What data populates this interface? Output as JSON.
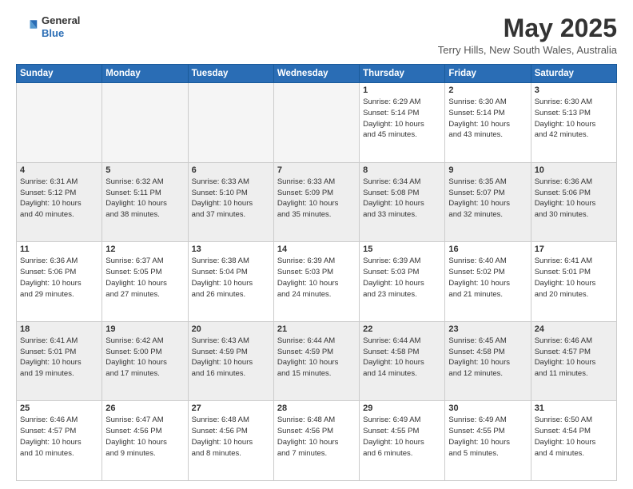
{
  "header": {
    "logo_general": "General",
    "logo_blue": "Blue",
    "title": "May 2025",
    "subtitle": "Terry Hills, New South Wales, Australia"
  },
  "calendar": {
    "days_of_week": [
      "Sunday",
      "Monday",
      "Tuesday",
      "Wednesday",
      "Thursday",
      "Friday",
      "Saturday"
    ],
    "weeks": [
      {
        "style": "white",
        "days": [
          {
            "num": "",
            "info": "",
            "empty": true
          },
          {
            "num": "",
            "info": "",
            "empty": true
          },
          {
            "num": "",
            "info": "",
            "empty": true
          },
          {
            "num": "",
            "info": "",
            "empty": true
          },
          {
            "num": "1",
            "info": "Sunrise: 6:29 AM\nSunset: 5:14 PM\nDaylight: 10 hours\nand 45 minutes.",
            "empty": false
          },
          {
            "num": "2",
            "info": "Sunrise: 6:30 AM\nSunset: 5:14 PM\nDaylight: 10 hours\nand 43 minutes.",
            "empty": false
          },
          {
            "num": "3",
            "info": "Sunrise: 6:30 AM\nSunset: 5:13 PM\nDaylight: 10 hours\nand 42 minutes.",
            "empty": false
          }
        ]
      },
      {
        "style": "gray",
        "days": [
          {
            "num": "4",
            "info": "Sunrise: 6:31 AM\nSunset: 5:12 PM\nDaylight: 10 hours\nand 40 minutes.",
            "empty": false
          },
          {
            "num": "5",
            "info": "Sunrise: 6:32 AM\nSunset: 5:11 PM\nDaylight: 10 hours\nand 38 minutes.",
            "empty": false
          },
          {
            "num": "6",
            "info": "Sunrise: 6:33 AM\nSunset: 5:10 PM\nDaylight: 10 hours\nand 37 minutes.",
            "empty": false
          },
          {
            "num": "7",
            "info": "Sunrise: 6:33 AM\nSunset: 5:09 PM\nDaylight: 10 hours\nand 35 minutes.",
            "empty": false
          },
          {
            "num": "8",
            "info": "Sunrise: 6:34 AM\nSunset: 5:08 PM\nDaylight: 10 hours\nand 33 minutes.",
            "empty": false
          },
          {
            "num": "9",
            "info": "Sunrise: 6:35 AM\nSunset: 5:07 PM\nDaylight: 10 hours\nand 32 minutes.",
            "empty": false
          },
          {
            "num": "10",
            "info": "Sunrise: 6:36 AM\nSunset: 5:06 PM\nDaylight: 10 hours\nand 30 minutes.",
            "empty": false
          }
        ]
      },
      {
        "style": "white",
        "days": [
          {
            "num": "11",
            "info": "Sunrise: 6:36 AM\nSunset: 5:06 PM\nDaylight: 10 hours\nand 29 minutes.",
            "empty": false
          },
          {
            "num": "12",
            "info": "Sunrise: 6:37 AM\nSunset: 5:05 PM\nDaylight: 10 hours\nand 27 minutes.",
            "empty": false
          },
          {
            "num": "13",
            "info": "Sunrise: 6:38 AM\nSunset: 5:04 PM\nDaylight: 10 hours\nand 26 minutes.",
            "empty": false
          },
          {
            "num": "14",
            "info": "Sunrise: 6:39 AM\nSunset: 5:03 PM\nDaylight: 10 hours\nand 24 minutes.",
            "empty": false
          },
          {
            "num": "15",
            "info": "Sunrise: 6:39 AM\nSunset: 5:03 PM\nDaylight: 10 hours\nand 23 minutes.",
            "empty": false
          },
          {
            "num": "16",
            "info": "Sunrise: 6:40 AM\nSunset: 5:02 PM\nDaylight: 10 hours\nand 21 minutes.",
            "empty": false
          },
          {
            "num": "17",
            "info": "Sunrise: 6:41 AM\nSunset: 5:01 PM\nDaylight: 10 hours\nand 20 minutes.",
            "empty": false
          }
        ]
      },
      {
        "style": "gray",
        "days": [
          {
            "num": "18",
            "info": "Sunrise: 6:41 AM\nSunset: 5:01 PM\nDaylight: 10 hours\nand 19 minutes.",
            "empty": false
          },
          {
            "num": "19",
            "info": "Sunrise: 6:42 AM\nSunset: 5:00 PM\nDaylight: 10 hours\nand 17 minutes.",
            "empty": false
          },
          {
            "num": "20",
            "info": "Sunrise: 6:43 AM\nSunset: 4:59 PM\nDaylight: 10 hours\nand 16 minutes.",
            "empty": false
          },
          {
            "num": "21",
            "info": "Sunrise: 6:44 AM\nSunset: 4:59 PM\nDaylight: 10 hours\nand 15 minutes.",
            "empty": false
          },
          {
            "num": "22",
            "info": "Sunrise: 6:44 AM\nSunset: 4:58 PM\nDaylight: 10 hours\nand 14 minutes.",
            "empty": false
          },
          {
            "num": "23",
            "info": "Sunrise: 6:45 AM\nSunset: 4:58 PM\nDaylight: 10 hours\nand 12 minutes.",
            "empty": false
          },
          {
            "num": "24",
            "info": "Sunrise: 6:46 AM\nSunset: 4:57 PM\nDaylight: 10 hours\nand 11 minutes.",
            "empty": false
          }
        ]
      },
      {
        "style": "white",
        "days": [
          {
            "num": "25",
            "info": "Sunrise: 6:46 AM\nSunset: 4:57 PM\nDaylight: 10 hours\nand 10 minutes.",
            "empty": false
          },
          {
            "num": "26",
            "info": "Sunrise: 6:47 AM\nSunset: 4:56 PM\nDaylight: 10 hours\nand 9 minutes.",
            "empty": false
          },
          {
            "num": "27",
            "info": "Sunrise: 6:48 AM\nSunset: 4:56 PM\nDaylight: 10 hours\nand 8 minutes.",
            "empty": false
          },
          {
            "num": "28",
            "info": "Sunrise: 6:48 AM\nSunset: 4:56 PM\nDaylight: 10 hours\nand 7 minutes.",
            "empty": false
          },
          {
            "num": "29",
            "info": "Sunrise: 6:49 AM\nSunset: 4:55 PM\nDaylight: 10 hours\nand 6 minutes.",
            "empty": false
          },
          {
            "num": "30",
            "info": "Sunrise: 6:49 AM\nSunset: 4:55 PM\nDaylight: 10 hours\nand 5 minutes.",
            "empty": false
          },
          {
            "num": "31",
            "info": "Sunrise: 6:50 AM\nSunset: 4:54 PM\nDaylight: 10 hours\nand 4 minutes.",
            "empty": false
          }
        ]
      }
    ]
  }
}
